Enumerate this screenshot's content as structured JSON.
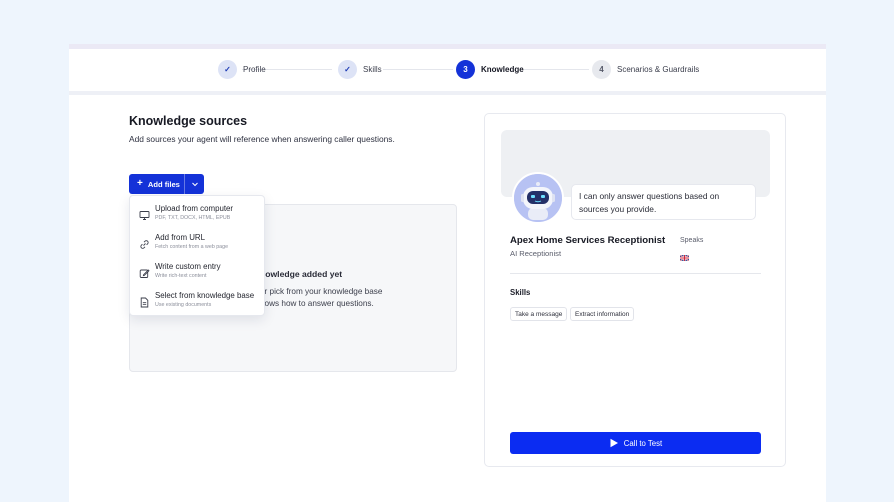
{
  "stepper": {
    "steps": [
      {
        "marker": "✓",
        "label": "Profile",
        "state": "done"
      },
      {
        "marker": "✓",
        "label": "Skills",
        "state": "done"
      },
      {
        "marker": "3",
        "label": "Knowledge",
        "state": "active"
      },
      {
        "marker": "4",
        "label": "Scenarios & Guardrails",
        "state": "todo"
      }
    ]
  },
  "knowledge": {
    "title": "Knowledge sources",
    "subtitle": "Add sources your agent will reference when answering caller questions.",
    "add_files_label": "Add files",
    "empty_title": "nowledge added yet",
    "empty_line1": "or pick from your knowledge base",
    "empty_line2": "nows how to answer questions."
  },
  "menu": {
    "items": [
      {
        "icon": "monitor-icon",
        "title": "Upload from computer",
        "sub": "PDF, TXT, DOCX, HTML, EPUB"
      },
      {
        "icon": "link-icon",
        "title": "Add from URL",
        "sub": "Fetch content from a web page"
      },
      {
        "icon": "edit-icon",
        "title": "Write custom entry",
        "sub": "Write rich-text content"
      },
      {
        "icon": "document-icon",
        "title": "Select from knowledge base",
        "sub": "Use existing documents"
      }
    ]
  },
  "preview": {
    "bubble_text": "I can only answer questions based on sources you provide.",
    "agent_name": "Apex Home Services Receptionist",
    "agent_role": "AI Receptionist",
    "speaks_label": "Speaks",
    "skills_heading": "Skills",
    "skills": [
      "Take a message",
      "Extract information"
    ],
    "call_label": "Call to Test"
  },
  "colors": {
    "accent": "#1432d8",
    "call_button": "#0b2cf2",
    "page_bg": "#eef5fd"
  }
}
